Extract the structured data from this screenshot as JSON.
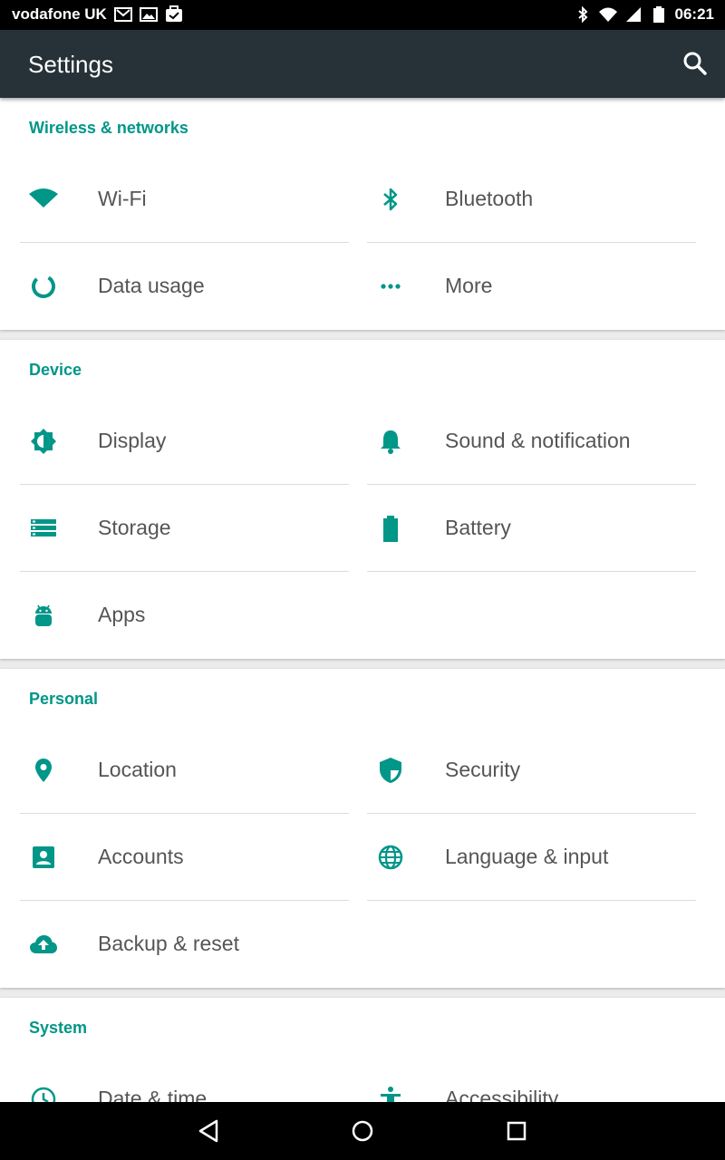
{
  "status_bar": {
    "carrier": "vodafone UK",
    "time": "06:21"
  },
  "toolbar": {
    "title": "Settings"
  },
  "sections": [
    {
      "title": "Wireless & networks",
      "items": [
        {
          "label": "Wi-Fi",
          "icon": "wifi-icon"
        },
        {
          "label": "Bluetooth",
          "icon": "bluetooth-icon"
        },
        {
          "label": "Data usage",
          "icon": "data-usage-icon"
        },
        {
          "label": "More",
          "icon": "more-icon"
        }
      ]
    },
    {
      "title": "Device",
      "items": [
        {
          "label": "Display",
          "icon": "display-icon"
        },
        {
          "label": "Sound & notification",
          "icon": "bell-icon"
        },
        {
          "label": "Storage",
          "icon": "storage-icon"
        },
        {
          "label": "Battery",
          "icon": "battery-icon"
        },
        {
          "label": "Apps",
          "icon": "android-icon"
        }
      ]
    },
    {
      "title": "Personal",
      "items": [
        {
          "label": "Location",
          "icon": "location-icon"
        },
        {
          "label": "Security",
          "icon": "shield-icon"
        },
        {
          "label": "Accounts",
          "icon": "account-icon"
        },
        {
          "label": "Language & input",
          "icon": "globe-icon"
        },
        {
          "label": "Backup & reset",
          "icon": "cloud-upload-icon"
        }
      ]
    },
    {
      "title": "System",
      "items": [
        {
          "label": "Date & time",
          "icon": "clock-icon"
        },
        {
          "label": "Accessibility",
          "icon": "accessibility-icon"
        }
      ]
    }
  ],
  "colors": {
    "accent": "#009688",
    "toolbar": "#263238",
    "text": "#555555"
  }
}
